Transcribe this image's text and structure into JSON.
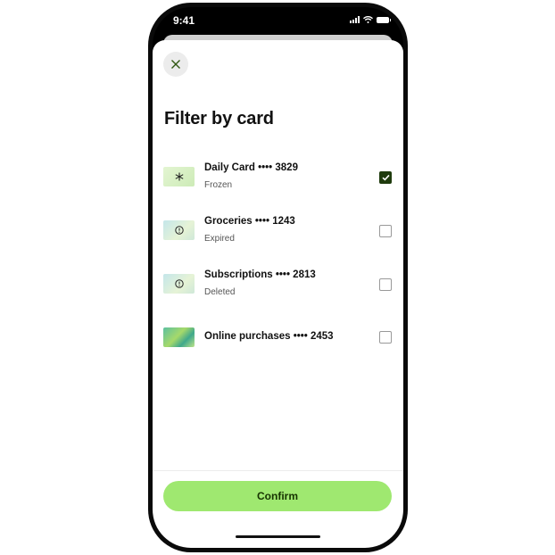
{
  "status_bar": {
    "time": "9:41",
    "icons": [
      "signal-icon",
      "wifi-icon",
      "battery-icon"
    ]
  },
  "sheet": {
    "close_icon": "close-icon",
    "title": "Filter by card",
    "cards": [
      {
        "name": "Daily Card ••••  3829",
        "status": "Frozen",
        "badge_icon": "snowflake-icon",
        "checked": true
      },
      {
        "name": "Groceries ••••  1243",
        "status": "Expired",
        "badge_icon": "alert-circle-icon",
        "checked": false
      },
      {
        "name": "Subscriptions ••••  2813",
        "status": "Deleted",
        "badge_icon": "alert-circle-icon",
        "checked": false
      },
      {
        "name": "Online purchases ••••  2453",
        "status": "",
        "badge_icon": "",
        "checked": false
      }
    ],
    "confirm_label": "Confirm"
  },
  "colors": {
    "accent": "#9fe870",
    "accent_text": "#163300",
    "checked": "#1f3b0d"
  }
}
